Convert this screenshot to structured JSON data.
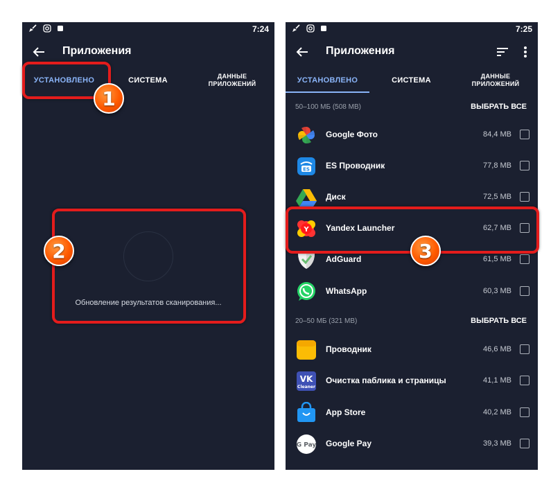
{
  "left_phone": {
    "status_time": "7:24",
    "title": "Приложения",
    "tabs": [
      "УСТАНОВЛЕНО",
      "СИСТЕМА",
      "ДАННЫЕ",
      "ПРИЛОЖЕНИЙ"
    ],
    "scan_text": "Обновление результатов сканирования..."
  },
  "right_phone": {
    "status_time": "7:25",
    "title": "Приложения",
    "tabs": [
      "УСТАНОВЛЕНО",
      "СИСТЕМА",
      "ДАННЫЕ",
      "ПРИЛОЖЕНИЙ"
    ],
    "sections": [
      {
        "label": "50–100 МБ (508 МВ)",
        "action": "ВЫБРАТЬ ВСЕ"
      },
      {
        "label": "20–50 МБ (321 МВ)",
        "action": "ВЫБРАТЬ ВСЕ"
      }
    ],
    "apps": [
      {
        "name": "Google Фото",
        "size": "84,4 MB",
        "icon": "google-photos-icon"
      },
      {
        "name": "ES Проводник",
        "size": "77,8 MB",
        "icon": "es-explorer-icon"
      },
      {
        "name": "Диск",
        "size": "72,5 MB",
        "icon": "google-drive-icon"
      },
      {
        "name": "Yandex Launcher",
        "size": "62,7 MB",
        "icon": "yandex-launcher-icon"
      },
      {
        "name": "AdGuard",
        "size": "61,5 MB",
        "icon": "adguard-icon"
      },
      {
        "name": "WhatsApp",
        "size": "60,3 MB",
        "icon": "whatsapp-icon"
      },
      {
        "name": "Проводник",
        "size": "46,6 MB",
        "icon": "file-manager-icon"
      },
      {
        "name": "Очистка паблика и страницы",
        "size": "41,1 MB",
        "icon": "vk-cleaner-icon"
      },
      {
        "name": "App Store",
        "size": "40,2 MB",
        "icon": "app-store-icon"
      },
      {
        "name": "Google Pay",
        "size": "39,3 MB",
        "icon": "google-pay-icon"
      }
    ]
  },
  "badges": [
    "1",
    "2",
    "3"
  ],
  "colors": {
    "background": "#1b2030",
    "accent_tab": "#8ab4f8",
    "highlight": "#e41c1c",
    "badge": "#ff6a00"
  }
}
